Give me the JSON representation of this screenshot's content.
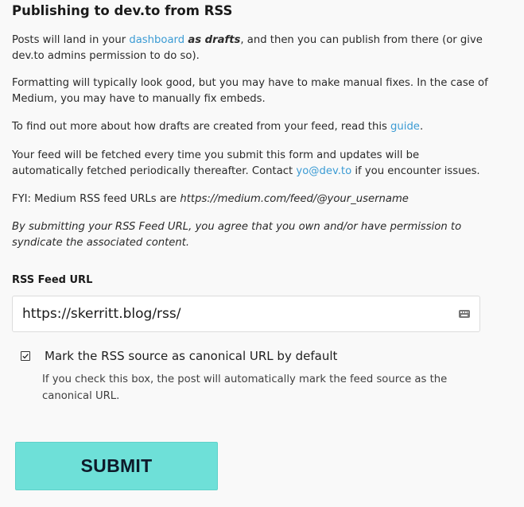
{
  "title": "Publishing to dev.to from RSS",
  "intro": {
    "p1_before": "Posts will land in your ",
    "p1_link": "dashboard",
    "p1_bold": "as drafts",
    "p1_after": ", and then you can publish from there (or give dev.to admins permission to do so).",
    "p2": "Formatting will typically look good, but you may have to make manual fixes. In the case of Medium, you may have to manually fix embeds.",
    "p3_before": "To find out more about how drafts are created from your feed, read this ",
    "p3_link": "guide",
    "p3_after": ".",
    "p4_before": "Your feed will be fetched every time you submit this form and updates will be automatically fetched periodically thereafter. Contact ",
    "p4_link": "yo@dev.to",
    "p4_after": " if you encounter issues.",
    "p5_before": "FYI: Medium RSS feed URLs are ",
    "p5_italic": "https://medium.com/feed/@your_username",
    "p6": "By submitting your RSS Feed URL, you agree that you own and/or have permission to syndicate the associated content."
  },
  "form": {
    "feed_label": "RSS Feed URL",
    "feed_value": "https://skerritt.blog/rss/",
    "canonical_label": "Mark the RSS source as canonical URL by default",
    "canonical_checked": true,
    "canonical_help": "If you check this box, the post will automatically mark the feed source as the canonical URL.",
    "submit_label": "SUBMIT"
  },
  "colors": {
    "link": "#3b9bd4",
    "submit_bg": "#6ee0d8",
    "page_bg": "#f9f9f9"
  },
  "icons": {
    "input_icon": "keyboard-icon",
    "checkbox_icon": "checkmark-icon"
  }
}
